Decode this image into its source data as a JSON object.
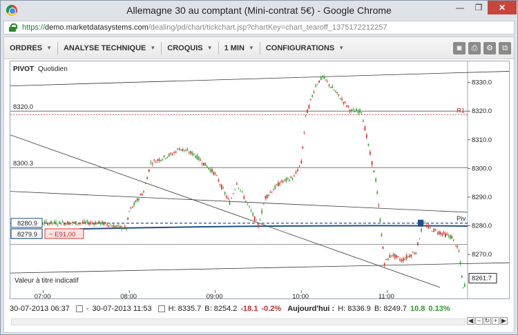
{
  "window": {
    "title": "Allemagne 30 au comptant (Mini-contrat 5€) - Google Chrome",
    "min_label": "—",
    "max_label": "❐",
    "close_label": "✕"
  },
  "address": {
    "scheme": "https://",
    "host": "demo.marketdatasystems.com",
    "path": "/dealing/pd/chart/tickchart.jsp?chartKey=chart_tearoff_1375172212257"
  },
  "menu": {
    "orders": "ORDRES",
    "analysis": "ANALYSE TECHNIQUE",
    "sketches": "CROQUIS",
    "interval": "1 MIN",
    "settings": "CONFIGURATIONS"
  },
  "tool_icons": [
    "camera-icon",
    "print-icon",
    "gear-icon",
    "popout-icon"
  ],
  "chart": {
    "pivot_label": "PIVOT",
    "period_label": "Quotidien",
    "disclaimer": "Valeur à titre indicatif",
    "r1_label": "R1",
    "piv_label": "Piv",
    "left_level_labels": [
      "8320.0",
      "8300.3"
    ],
    "price_badge_top": "8280.9",
    "price_badge_bottom": "8279.9",
    "order_badge": "− E91,00",
    "current_price": "8261.7",
    "y_ticks": [
      "8330.0",
      "8320.0",
      "8310.0",
      "8300.0",
      "8290.0",
      "8280.0",
      "8270.0"
    ],
    "x_ticks": [
      "07:00",
      "08:00",
      "09:00",
      "10:00",
      "11:00"
    ],
    "colors": {
      "up": "#3aa53a",
      "down": "#d9342b",
      "r1": "#c0292b",
      "price_line": "#1f4e8c"
    }
  },
  "status": {
    "from": "30-07-2013 06:37",
    "dash": "-",
    "to": "30-07-2013 11:53",
    "high": "H: 8335.7",
    "low": "B: 8254.2",
    "change": "-18.1",
    "change_pct": "-0.2%",
    "today_label": "Aujourd'hui :",
    "today_high": "H: 8336.9",
    "today_low": "B: 8249.7",
    "today_change": "10.8",
    "today_change_pct": "0.13%"
  },
  "chart_data": {
    "type": "candlestick",
    "title": "",
    "xlabel": "",
    "ylabel": "",
    "x_ticks": [
      "07:00",
      "08:00",
      "09:00",
      "10:00",
      "11:00"
    ],
    "y_ticks": [
      8330.0,
      8320.0,
      8310.0,
      8300.0,
      8290.0,
      8280.0,
      8270.0
    ],
    "ylim": [
      8258,
      8334
    ],
    "levels": [
      {
        "label": "R1",
        "value": 8318.7
      },
      {
        "label": "8320.0",
        "value": 8320.0
      },
      {
        "label": "8300.3",
        "value": 8300.3
      },
      {
        "label": "Piv",
        "value": 8280.9
      },
      {
        "label": "8279.9",
        "value": 8279.9
      }
    ],
    "current_price": 8261.7,
    "close_path": [
      [
        "06:40",
        8281
      ],
      [
        "07:10",
        8281
      ],
      [
        "07:40",
        8281
      ],
      [
        "07:58",
        8279
      ],
      [
        "08:00",
        8285
      ],
      [
        "08:10",
        8292
      ],
      [
        "08:15",
        8302
      ],
      [
        "08:30",
        8305
      ],
      [
        "08:35",
        8307
      ],
      [
        "08:45",
        8305
      ],
      [
        "09:00",
        8298
      ],
      [
        "09:10",
        8288
      ],
      [
        "09:15",
        8295
      ],
      [
        "09:20",
        8290
      ],
      [
        "09:25",
        8285
      ],
      [
        "09:30",
        8280
      ],
      [
        "09:35",
        8290
      ],
      [
        "09:45",
        8295
      ],
      [
        "09:55",
        8297
      ],
      [
        "10:00",
        8302
      ],
      [
        "10:03",
        8318
      ],
      [
        "10:10",
        8329
      ],
      [
        "10:15",
        8332
      ],
      [
        "10:25",
        8326
      ],
      [
        "10:35",
        8320
      ],
      [
        "10:42",
        8320
      ],
      [
        "10:48",
        8305
      ],
      [
        "10:52",
        8296
      ],
      [
        "10:55",
        8282
      ],
      [
        "10:58",
        8267
      ],
      [
        "11:03",
        8270
      ],
      [
        "11:10",
        8268
      ],
      [
        "11:20",
        8271
      ],
      [
        "11:25",
        8281
      ],
      [
        "11:30",
        8279
      ],
      [
        "11:35",
        8278
      ],
      [
        "11:45",
        8276
      ],
      [
        "11:50",
        8271
      ],
      [
        "11:53",
        8258
      ],
      [
        "11:55",
        8261
      ]
    ]
  }
}
